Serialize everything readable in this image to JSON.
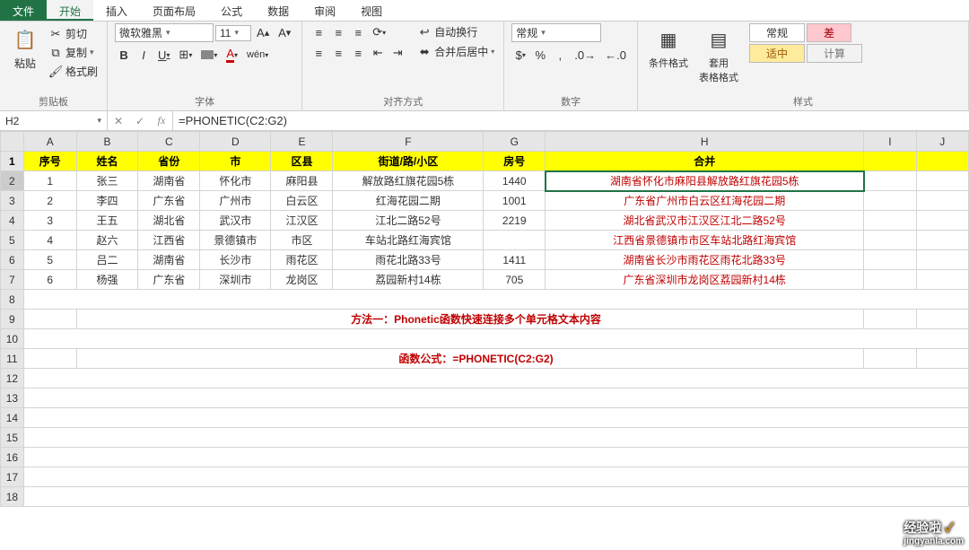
{
  "menu": {
    "file": "文件",
    "start": "开始",
    "insert": "插入",
    "layout": "页面布局",
    "formula": "公式",
    "data": "数据",
    "review": "审阅",
    "view": "视图"
  },
  "ribbon": {
    "clipboard": {
      "paste": "粘贴",
      "cut": "剪切",
      "copy": "复制",
      "brush": "格式刷",
      "label": "剪贴板"
    },
    "font": {
      "name": "微软雅黑",
      "size": "11",
      "label": "字体"
    },
    "align": {
      "wrap": "自动换行",
      "merge": "合并后居中",
      "label": "对齐方式"
    },
    "number": {
      "general": "常规",
      "label": "数字"
    },
    "style": {
      "cond": "条件格式",
      "as_table": "套用\n表格格式",
      "cells": [
        "常规",
        "差",
        "适中",
        "计算"
      ],
      "label": "样式"
    }
  },
  "formula_bar": {
    "cell": "H2",
    "value": "=PHONETIC(C2:G2)"
  },
  "cols": [
    "A",
    "B",
    "C",
    "D",
    "E",
    "F",
    "G",
    "H",
    "I",
    "J"
  ],
  "headers": [
    "序号",
    "姓名",
    "省份",
    "市",
    "区县",
    "街道/路/小区",
    "房号",
    "合并"
  ],
  "rows": [
    {
      "n": "1",
      "name": "张三",
      "prov": "湖南省",
      "city": "怀化市",
      "dist": "麻阳县",
      "street": "解放路红旗花园5栋",
      "room": "1440",
      "merged": "湖南省怀化市麻阳县解放路红旗花园5栋"
    },
    {
      "n": "2",
      "name": "李四",
      "prov": "广东省",
      "city": "广州市",
      "dist": "白云区",
      "street": "红海花园二期",
      "room": "1001",
      "merged": "广东省广州市白云区红海花园二期"
    },
    {
      "n": "3",
      "name": "王五",
      "prov": "湖北省",
      "city": "武汉市",
      "dist": "江汉区",
      "street": "江北二路52号",
      "room": "2219",
      "merged": "湖北省武汉市江汉区江北二路52号"
    },
    {
      "n": "4",
      "name": "赵六",
      "prov": "江西省",
      "city": "景德镇市",
      "dist": "市区",
      "street": "车站北路红海宾馆",
      "room": "",
      "merged": "江西省景德镇市市区车站北路红海宾馆"
    },
    {
      "n": "5",
      "name": "吕二",
      "prov": "湖南省",
      "city": "长沙市",
      "dist": "雨花区",
      "street": "雨花北路33号",
      "room": "1411",
      "merged": "湖南省长沙市雨花区雨花北路33号"
    },
    {
      "n": "6",
      "name": "杨强",
      "prov": "广东省",
      "city": "深圳市",
      "dist": "龙岗区",
      "street": "荔园新村14栋",
      "room": "705",
      "merged": "广东省深圳市龙岗区荔园新村14栋"
    }
  ],
  "notes": {
    "line1": "方法一：Phonetic函数快速连接多个单元格文本内容",
    "line2": "函数公式：=PHONETIC(C2:G2)"
  },
  "watermark": {
    "brand": "经验啦",
    "check": "✓",
    "url": "jingyanla.com"
  }
}
